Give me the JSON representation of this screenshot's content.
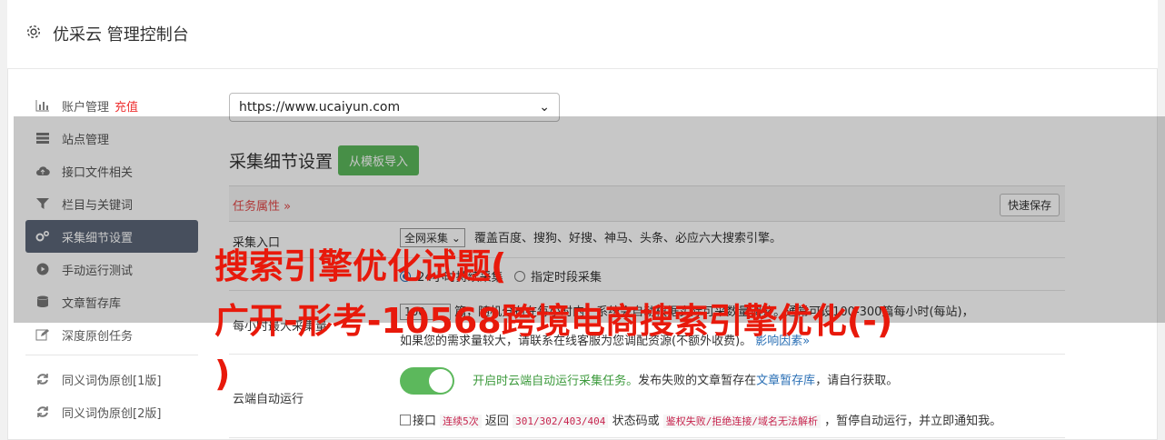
{
  "header": {
    "title": "优采云 管理控制台",
    "icon": "gear-icon"
  },
  "sidebar": {
    "items": [
      {
        "label": "账户管理",
        "extra": "充值",
        "icon": "bar-chart-icon"
      },
      {
        "label": "站点管理",
        "icon": "server-icon"
      },
      {
        "label": "接口文件相关",
        "icon": "cloud-upload-icon"
      },
      {
        "label": "栏目与关键词",
        "icon": "filter-icon"
      },
      {
        "label": "采集细节设置",
        "icon": "cogs-icon",
        "active": true
      },
      {
        "label": "手动运行测试",
        "icon": "play-circle-icon"
      },
      {
        "label": "文章暂存库",
        "icon": "database-icon"
      },
      {
        "label": "深度原创任务",
        "icon": "edit-icon"
      },
      {
        "label": "同义词伪原创[1版]",
        "icon": "refresh-icon"
      },
      {
        "label": "同义词伪原创[2版]",
        "icon": "refresh-icon"
      }
    ]
  },
  "main": {
    "site_select": "https://www.ucaiyun.com",
    "section_title": "采集细节设置",
    "import_button": "从模板导入",
    "attr_label": "任务属性 »",
    "quick_save": "快速保存",
    "entry": {
      "label": "采集入口",
      "select": "全网采集",
      "desc": "覆盖百度、搜狗、好搜、神马、头条、必应六大搜索引擎。"
    },
    "period": {
      "option_a": "24小时持续采集",
      "option_b": "指定时段采集"
    },
    "rate": {
      "label": "每小时最大采集量",
      "value": "100",
      "desc": "篇，随机分布在每小时内，系统会自动根据实际可采数量调整。通常可设100-300篇每小时(每站)，",
      "desc2": "如果您的需求量较大，请联系在线客服为您调配资源(不额外收费)。",
      "link": "影响因素»"
    },
    "cloud": {
      "label": "云端自动运行",
      "green_text": "开启时云端自动运行采集任务。",
      "text": "发布失败的文章暂存在",
      "link": "文章暂存库",
      "text2": "，请自行获取。",
      "rule_prefix": "接口",
      "code1": "连续5次",
      "rule_mid": "返回",
      "code2": "301/302/403/404",
      "rule_mid2": "状态码或",
      "code3": "鉴权失败/拒绝连接/域名无法解析",
      "rule_end": "，暂停自动运行，并立即通知我。"
    }
  },
  "overlay_text": {
    "line1": "搜索引擎优化试题(",
    "line2": "广开-形考-10568跨境电商搜索引擎优化(-)",
    "line3": ")"
  }
}
